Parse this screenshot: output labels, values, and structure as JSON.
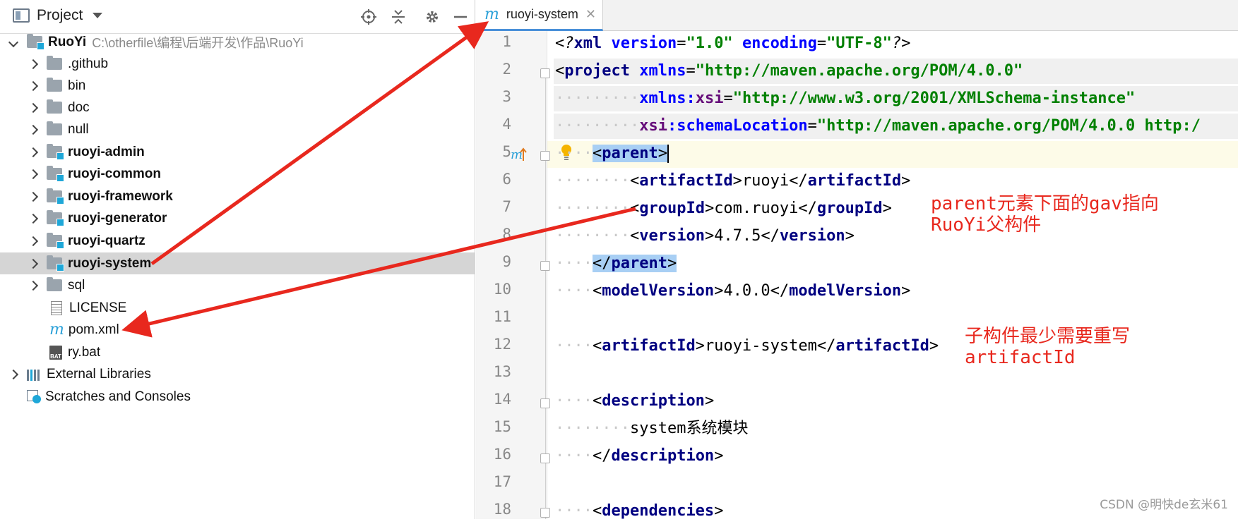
{
  "panel": {
    "title": "Project"
  },
  "tree": {
    "root_name": "RuoYi",
    "root_path": "C:\\otherfile\\编程\\后端开发\\作品\\RuoYi",
    "items": [
      {
        "label": ".github"
      },
      {
        "label": "bin"
      },
      {
        "label": "doc"
      },
      {
        "label": "null"
      },
      {
        "label": "ruoyi-admin"
      },
      {
        "label": "ruoyi-common"
      },
      {
        "label": "ruoyi-framework"
      },
      {
        "label": "ruoyi-generator"
      },
      {
        "label": "ruoyi-quartz"
      },
      {
        "label": "ruoyi-system"
      },
      {
        "label": "sql"
      },
      {
        "label": "LICENSE"
      },
      {
        "label": "pom.xml"
      },
      {
        "label": "ry.bat"
      }
    ],
    "external_libraries": "External Libraries",
    "scratches": "Scratches and Consoles",
    "bat_badge": "BAT"
  },
  "editor": {
    "tab_label": "ruoyi-system",
    "tab_icon_letter": "m",
    "line_numbers": [
      "1",
      "2",
      "3",
      "4",
      "5",
      "6",
      "7",
      "8",
      "9",
      "10",
      "11",
      "12",
      "13",
      "14",
      "15",
      "16",
      "17",
      "18"
    ],
    "lines": {
      "l1": {
        "a": "<?",
        "b": "xml ",
        "c": "version",
        "d": "=",
        "e": "\"1.0\"",
        "f": " ",
        "g": "encoding",
        "h": "=",
        "i": "\"UTF-8\"",
        "j": "?>"
      },
      "l2": {
        "a": "<",
        "b": "project ",
        "c": "xmlns",
        "d": "=",
        "e": "\"http://maven.apache.org/POM/4.0.0\""
      },
      "l3": {
        "dots": "·········",
        "a": "xmlns:",
        "b": "xsi",
        "c": "=",
        "d": "\"http://www.w3.org/2001/XMLSchema-instance\""
      },
      "l4": {
        "dots": "·········",
        "a": "xsi",
        "b": ":schemaLocation",
        "c": "=",
        "d": "\"http://maven.apache.org/POM/4.0.0 http:/"
      },
      "l5": {
        "dots": "····",
        "a": "<",
        "b": "parent",
        "c": ">"
      },
      "l6": {
        "dots": "········",
        "a": "<",
        "b": "artifactId",
        "c": ">",
        "d": "ruoyi",
        "e": "</",
        "f": "artifactId",
        "g": ">"
      },
      "l7": {
        "dots": "········",
        "a": "<",
        "b": "groupId",
        "c": ">",
        "d": "com.ruoyi",
        "e": "</",
        "f": "groupId",
        "g": ">"
      },
      "l8": {
        "dots": "········",
        "a": "<",
        "b": "version",
        "c": ">",
        "d": "4.7.5",
        "e": "</",
        "f": "version",
        "g": ">"
      },
      "l9": {
        "dots": "····",
        "a": "</",
        "b": "parent",
        "c": ">"
      },
      "l10": {
        "dots": "····",
        "a": "<",
        "b": "modelVersion",
        "c": ">",
        "d": "4.0.0",
        "e": "</",
        "f": "modelVersion",
        "g": ">"
      },
      "l12": {
        "dots": "····",
        "a": "<",
        "b": "artifactId",
        "c": ">",
        "d": "ruoyi-system",
        "e": "</",
        "f": "artifactId",
        "g": ">"
      },
      "l14": {
        "dots": "····",
        "a": "<",
        "b": "description",
        "c": ">"
      },
      "l15": {
        "dots": "········",
        "a": "system系统模块"
      },
      "l16": {
        "dots": "····",
        "a": "</",
        "b": "description",
        "c": ">"
      },
      "l18": {
        "dots": "····",
        "a": "<",
        "b": "dependencies",
        "c": ">"
      }
    }
  },
  "annotations": {
    "parent_note": "parent元素下面的gav指向\nRuoYi父构件",
    "artifact_note": "子构件最少需要重写\nartifactId"
  },
  "watermark": "CSDN @明快de玄米61",
  "colors": {
    "annotation": "#e8281e",
    "selection": "#a8cff4",
    "tag": "#000080",
    "attr": "#0000ff",
    "string": "#008000",
    "namespace": "#660e7a"
  }
}
